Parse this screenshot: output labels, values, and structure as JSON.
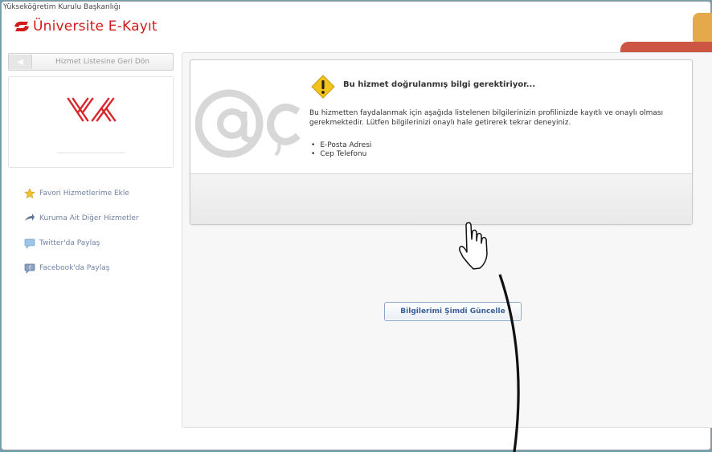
{
  "header": {
    "org_name": "Yükseköğretim Kurulu Başkanlığı",
    "app_title": "Üniversite E-Kayıt"
  },
  "sidebar": {
    "back_button": "Hizmet Listesine Geri Dön",
    "logo": {
      "icon": "yok-logo",
      "text": "YÖK"
    },
    "links": [
      {
        "label": "Favori Hizmetlerime Ekle",
        "icon": "star-icon"
      },
      {
        "label": "Kuruma Ait Diğer Hizmetler",
        "icon": "share-arrow-icon"
      },
      {
        "label": "Twitter'da Paylaş",
        "icon": "twitter-icon"
      },
      {
        "label": "Facebook'da Paylaş",
        "icon": "facebook-icon"
      }
    ]
  },
  "notice": {
    "title": "Bu hizmet doğrulanmış bilgi gerektiriyor...",
    "body": "Bu hizmetten faydalanmak için aşağıda listelenen bilgilerinizin profilinizde kayıtlı ve onaylı olması gerekmektedir. Lütfen bilgilerinizi onaylı hale getirerek tekrar deneyiniz.",
    "requirements": [
      "E-Posta Adresi",
      "Cep Telefonu"
    ],
    "button": "Bilgilerimi Şimdi Güncelle"
  },
  "colors": {
    "brand_red": "#d11b1b",
    "link_blue": "#6f82a3",
    "button_text": "#3a5f95",
    "warning_yellow": "#f2c21b"
  }
}
